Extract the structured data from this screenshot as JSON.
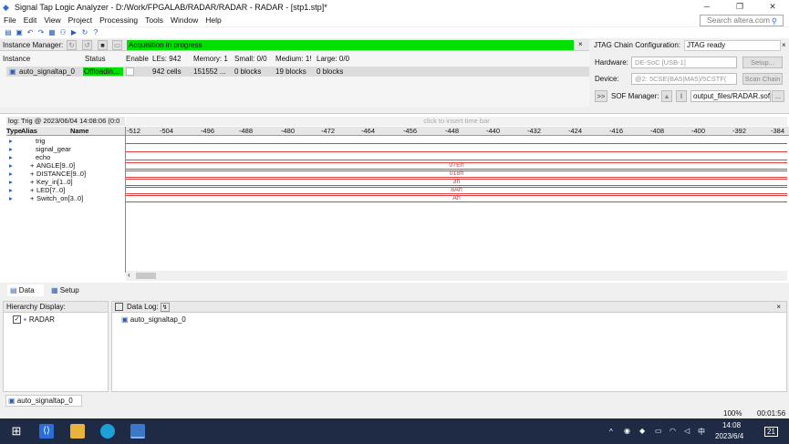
{
  "window": {
    "title": "Signal Tap Logic Analyzer - D:/Work/FPGALAB/RADAR/RADAR - RADAR - [stp1.stp]*",
    "controls": [
      "─",
      "❐",
      "✕"
    ]
  },
  "menu": [
    "File",
    "Edit",
    "View",
    "Project",
    "Processing",
    "Tools",
    "Window",
    "Help"
  ],
  "search": {
    "placeholder": "Search altera.com"
  },
  "instance_manager": {
    "label": "Instance Manager:",
    "status": "Acquisition in progress",
    "columns": [
      "Instance",
      "Status",
      "Enable",
      "LEs: 942",
      "Memory: 1",
      "Small: 0/0",
      "Medium: 1!",
      "Large: 0/0"
    ],
    "row": {
      "instance": "auto_signaltap_0",
      "status": "Offloadin...",
      "les": "942 cells",
      "memory": "151552 ...",
      "small": "0 blocks",
      "medium": "19 blocks",
      "large": "0 blocks"
    }
  },
  "jtag": {
    "label": "JTAG Chain Configuration:",
    "status": "JTAG ready",
    "hardware_label": "Hardware:",
    "hardware_value": "DE-SoC [USB-1]",
    "setup_button": "Setup...",
    "device_label": "Device:",
    "device_value": "@2: 5CSE(BA5|MA5)/5CSTF(",
    "scan_button": "Scan Chain",
    "expand_button": ">>",
    "sof_label": "SOF Manager:",
    "sof_path": "output_files/RADAR.sof",
    "sof_browse": "..."
  },
  "waveform": {
    "log_label": "log: Trig @ 2023/06/04 14:08:06 (0:0",
    "insert_hint": "click to insert time bar",
    "columns": {
      "type": "Type",
      "alias": "Alias",
      "name": "Name"
    },
    "ticks": [
      "-512",
      "-504",
      "-496",
      "-488",
      "-480",
      "-472",
      "-464",
      "-456",
      "-448",
      "-440",
      "-432",
      "-424",
      "-416",
      "-408",
      "-400",
      "-392",
      "-384"
    ],
    "signals": [
      {
        "name": "trig",
        "value": ""
      },
      {
        "name": "signal_gear",
        "value": ""
      },
      {
        "name": "echo",
        "value": ""
      },
      {
        "name": "ANGLE[9..0]",
        "value": "07Eh"
      },
      {
        "name": "DISTANCE[9..0]",
        "value": "018h"
      },
      {
        "name": "Key_in[1..0]",
        "value": "3h"
      },
      {
        "name": "LED[7..0]",
        "value": "8Ah"
      },
      {
        "name": "Switch_on[3..0]",
        "value": "Ah"
      }
    ]
  },
  "tabs": {
    "data": "Data",
    "setup": "Setup"
  },
  "hierarchy": {
    "label": "Hierarchy Display:",
    "item": "RADAR"
  },
  "datalog": {
    "label": "Data Log:",
    "item": "auto_signaltap_0"
  },
  "bottom_tab": "auto_signaltap_0",
  "statusbar": {
    "zoom": "100%",
    "time": "00:01:56"
  },
  "taskbar": {
    "time": "14:08",
    "date": "2023/6/4",
    "lang": "中",
    "notif": "21"
  },
  "colors": {
    "accent_green": "#00e000",
    "wave_red": "#e04040",
    "taskbar": "#1f2a44"
  }
}
